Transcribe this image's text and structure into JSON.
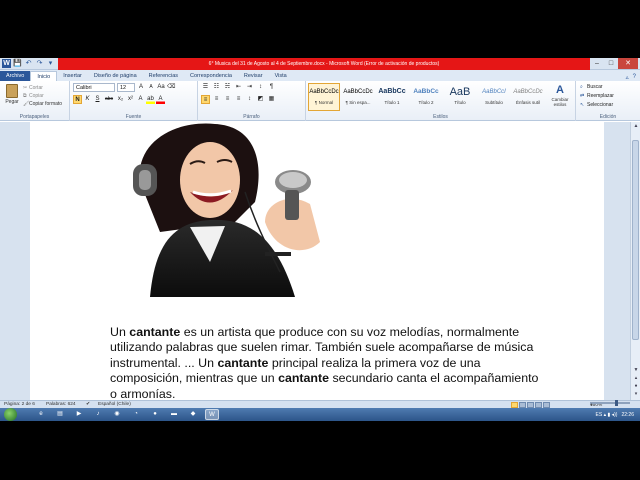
{
  "window": {
    "title": "6° Musica del 31 de Agosto al 4 de Septiembre.docx - Microsoft Word (Error de activación de productos)"
  },
  "qat": {
    "word_logo": "W",
    "save": "💾",
    "undo": "↶",
    "redo": "↷",
    "customize": "▾"
  },
  "window_buttons": {
    "minimize": "–",
    "maximize": "□",
    "close": "✕"
  },
  "tabs": [
    {
      "label": "Archivo"
    },
    {
      "label": "Inicio"
    },
    {
      "label": "Insertar"
    },
    {
      "label": "Diseño de página"
    },
    {
      "label": "Referencias"
    },
    {
      "label": "Correspondencia"
    },
    {
      "label": "Revisar"
    },
    {
      "label": "Vista"
    }
  ],
  "ribbon": {
    "clipboard": {
      "paste": "Pegar",
      "cut": "Cortar",
      "copy": "Copiar",
      "format_painter": "Copiar formato",
      "label": "Portapapeles"
    },
    "font": {
      "name": "Calibri",
      "size": "12",
      "grow": "A",
      "shrink": "A",
      "case": "Aa",
      "clear": "⌫",
      "bold": "N",
      "italic": "K",
      "underline": "S",
      "strike": "abc",
      "subscript": "x₂",
      "superscript": "x²",
      "effects": "A",
      "highlight": "ab",
      "color": "A",
      "label": "Fuente"
    },
    "paragraph": {
      "bullets": "☰",
      "numbering": "☷",
      "multilevel": "☵",
      "decrease_indent": "⇤",
      "increase_indent": "⇥",
      "sort": "↕",
      "show_marks": "¶",
      "align_left": "≡",
      "center": "≡",
      "align_right": "≡",
      "justify": "≡",
      "line_spacing": "↕",
      "shading": "◩",
      "borders": "▦",
      "label": "Párrafo"
    },
    "styles": {
      "items": [
        {
          "preview": "AaBbCcDc",
          "name": "¶ Normal"
        },
        {
          "preview": "AaBbCcDc",
          "name": "¶ Sin espa..."
        },
        {
          "preview": "AaBbCc",
          "name": "Título 1"
        },
        {
          "preview": "AaBbCc",
          "name": "Título 2"
        },
        {
          "preview": "AaB",
          "name": "Título"
        },
        {
          "preview": "AaBbCcI",
          "name": "Subtítulo"
        },
        {
          "preview": "AaBbCcDc",
          "name": "Énfasis sutil"
        }
      ],
      "change_styles_icon": "A",
      "change_styles": "Cambiar estilos",
      "label": "Estilos"
    },
    "editing": {
      "find": "Buscar",
      "replace": "Reemplazar",
      "select": "Seleccionar",
      "label": "Edición"
    }
  },
  "document": {
    "paragraph": [
      {
        "text": "Un ",
        "bold": false
      },
      {
        "text": "cantante",
        "bold": true
      },
      {
        "text": " es un artista que produce con su voz melodías, normalmente utilizando palabras que suelen rimar. También suele acompañarse de música instrumental. ... Un ",
        "bold": false
      },
      {
        "text": "cantante",
        "bold": true
      },
      {
        "text": " principal realiza la primera voz de una composición, mientras que un ",
        "bold": false
      },
      {
        "text": "cantante",
        "bold": true
      },
      {
        "text": " secundario canta el acompañamiento o armonías.",
        "bold": false
      }
    ]
  },
  "statusbar": {
    "page": "Página: 2 de 6",
    "words": "Palabras: 624",
    "language": "Español (Chile)",
    "zoom": "150%",
    "zoom_minus": "–",
    "zoom_plus": "+"
  },
  "scroll": {
    "up": "▲",
    "down": "▼",
    "prev_page": "▴",
    "browse": "●",
    "next_page": "▾"
  },
  "taskbar": {
    "icons": [
      "e",
      "▤",
      "▶",
      "♪",
      "◉",
      "◔",
      "●",
      "▬",
      "◆",
      "W"
    ],
    "tray_icons": "ES ▴ ▮ ◂))",
    "clock": "22:26"
  },
  "colors": {
    "title_red": "#e51616",
    "word_blue": "#2b579a",
    "ribbon_bg": "#ffffff",
    "taskbar": "#2c5589"
  }
}
